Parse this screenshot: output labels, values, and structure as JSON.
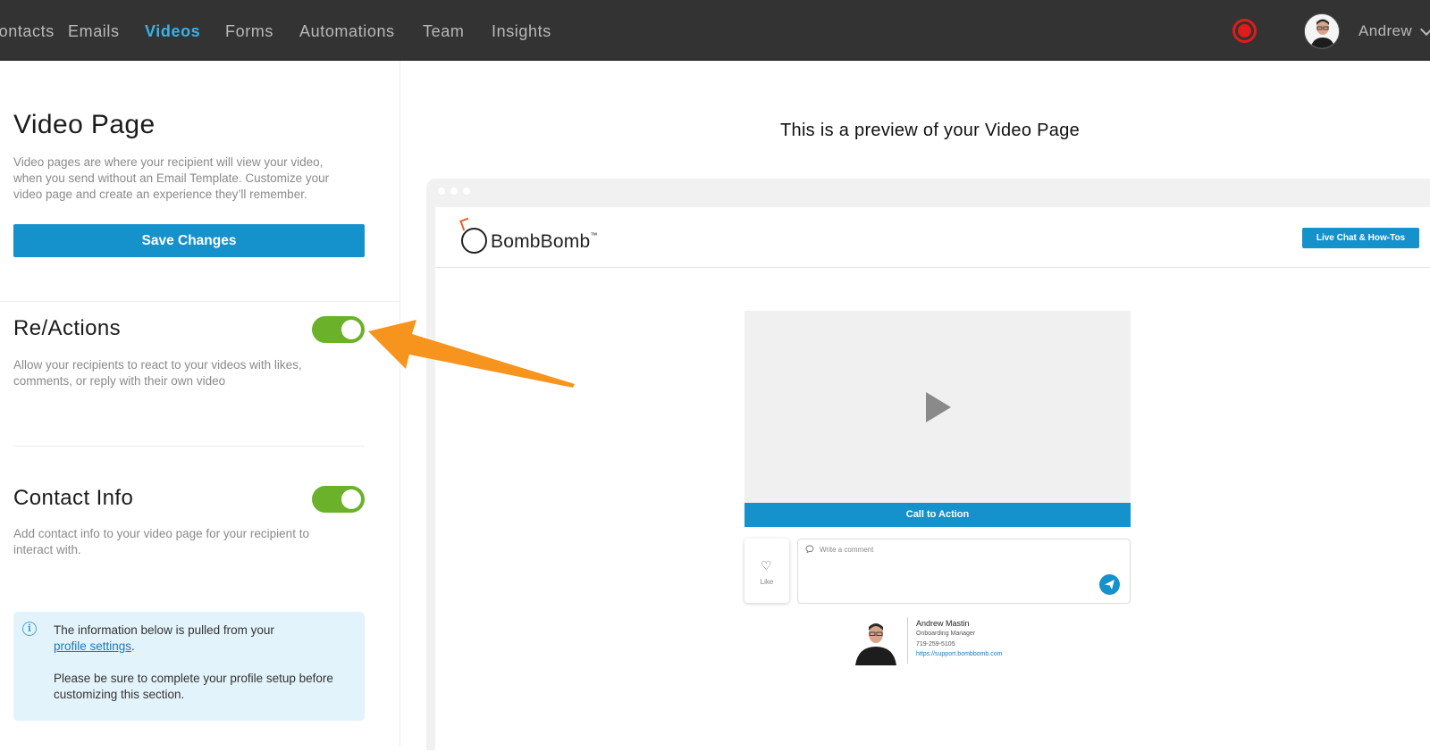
{
  "nav": {
    "items": [
      {
        "label": "Contacts",
        "active": false
      },
      {
        "label": "Emails",
        "active": false
      },
      {
        "label": "Videos",
        "active": true
      },
      {
        "label": "Forms",
        "active": false
      },
      {
        "label": "Automations",
        "active": false
      },
      {
        "label": "Team",
        "active": false
      },
      {
        "label": "Insights",
        "active": false
      }
    ],
    "user_name": "Andrew",
    "record_icon": "record-icon"
  },
  "left": {
    "title": "Video Page",
    "description": "Video pages are where your recipient will view your video, when you send without an Email Template. Customize your video page and create an experience they’ll remember.",
    "save_label": "Save Changes",
    "reactions": {
      "title": "Re/Actions",
      "enabled": true,
      "description": "Allow your recipients to react to your videos with likes, comments, or reply with their own video"
    },
    "contact_info": {
      "title": "Contact Info",
      "enabled": true,
      "description": "Add contact info to your video page for your recipient to interact with."
    },
    "info_box": {
      "line1": "The information below is pulled from your",
      "link": "profile settings",
      "line1_end": ".",
      "line2": "Please be sure to complete your profile setup before customizing this section."
    }
  },
  "preview": {
    "title": "This is a preview of your Video Page",
    "logo_text": "BombBomb",
    "logo_tm": "™",
    "live_chat_label": "Live Chat & How-Tos",
    "cta_label": "Call to Action",
    "like_label": "Like",
    "comment_placeholder": "Write a comment",
    "signature": {
      "name": "Andrew Mastin",
      "title": "Onboarding Manager",
      "phone": "719-259-5105",
      "url": "https://support.bombbomb.com"
    }
  },
  "colors": {
    "accent": "#1591cc",
    "nav_active": "#3ab2e6",
    "toggle_on": "#6bb12a",
    "record": "#e11b1b",
    "annotation_arrow": "#f7941d"
  }
}
